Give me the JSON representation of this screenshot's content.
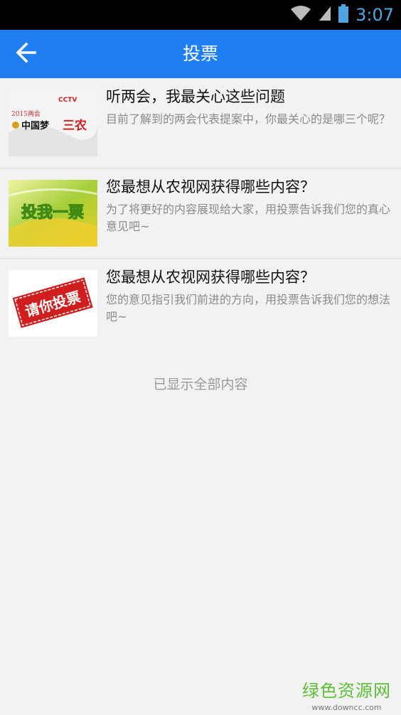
{
  "status_bar": {
    "time": "3:07",
    "icons": [
      "wifi-icon",
      "signal-icon",
      "battery-icon"
    ]
  },
  "app_bar": {
    "title": "投票",
    "back_icon": "arrow-left-icon",
    "color": "#1f7ff2"
  },
  "items": [
    {
      "title": "听两会，我最关心这些问题",
      "desc": "目前了解到的两会代表提案中，你最关心的是哪三个呢？",
      "thumb": {
        "type": "banner",
        "lines": [
          "CCTV",
          "2015两会",
          "中国梦",
          "三农"
        ]
      }
    },
    {
      "title": "您最想从农视网获得哪些内容？",
      "desc": "为了将更好的内容展现给大家，用投票告诉我们您的真心意见吧~",
      "thumb": {
        "type": "banner",
        "lines": [
          "投我一票"
        ]
      }
    },
    {
      "title": "您最想从农视网获得哪些内容？",
      "desc": "您的意见指引我们前进的方向，用投票告诉我们您的想法吧~",
      "thumb": {
        "type": "stamp",
        "lines": [
          "请你投票"
        ]
      }
    }
  ],
  "footer_note": "已显示全部内容",
  "watermark": {
    "main": "绿色资源网",
    "sub": "www.downcc.com"
  }
}
